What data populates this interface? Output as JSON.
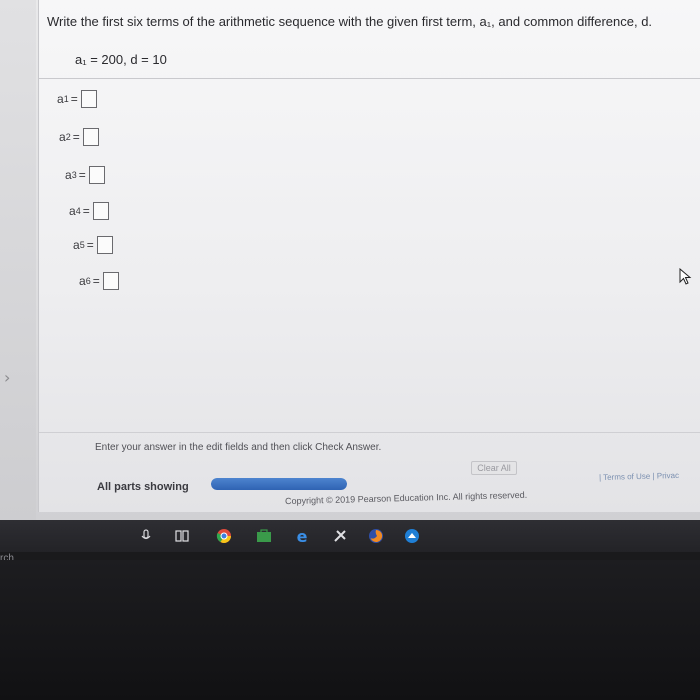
{
  "question": {
    "text": "Write the first six terms of the arithmetic sequence with the given first term, a₁, and common difference, d."
  },
  "given": {
    "text": "a₁ = 200, d = 10"
  },
  "terms": [
    {
      "var": "a",
      "sub": "1",
      "eq": "=",
      "value": ""
    },
    {
      "var": "a",
      "sub": "2",
      "eq": "=",
      "value": ""
    },
    {
      "var": "a",
      "sub": "3",
      "eq": "=",
      "value": ""
    },
    {
      "var": "a",
      "sub": "4",
      "eq": "=",
      "value": ""
    },
    {
      "var": "a",
      "sub": "5",
      "eq": "=",
      "value": ""
    },
    {
      "var": "a",
      "sub": "6",
      "eq": "=",
      "value": ""
    }
  ],
  "footer": {
    "instructions": "Enter your answer in the edit fields and then click Check Answer.",
    "parts_label": "All parts showing",
    "clear_all": "Clear All",
    "copyright": "Copyright © 2019 Pearson Education Inc. All rights reserved.",
    "links": "| Terms of Use | Privac"
  },
  "taskbar": {
    "search_text": "rch",
    "icons": [
      "microphone-icon",
      "task-view-icon",
      "chrome-icon",
      "store-icon",
      "edge-icon",
      "app-icon",
      "firefox-icon",
      "blue-app-icon"
    ]
  },
  "colors": {
    "progress": "#2f63b3",
    "panel": "#f4f4f5",
    "taskbar": "#2a2a2e"
  }
}
